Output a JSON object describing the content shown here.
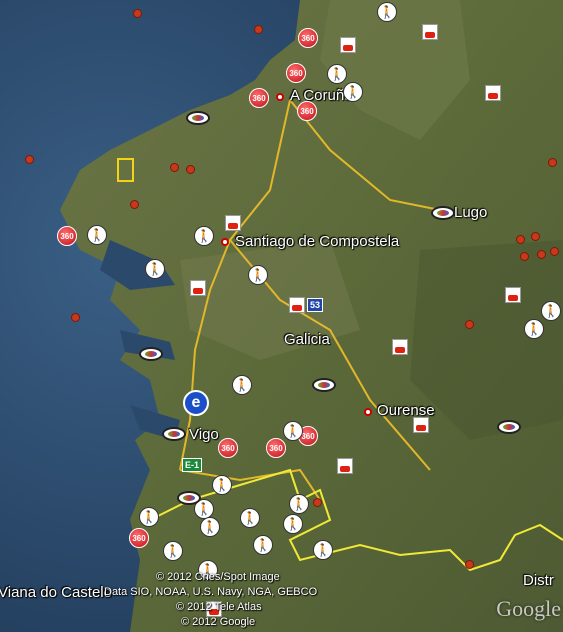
{
  "map": {
    "cities": [
      {
        "name": "A Coruña"
      },
      {
        "name": "Santiago de Compostela"
      },
      {
        "name": "Lugo"
      },
      {
        "name": "Ourense"
      },
      {
        "name": "Vigo"
      },
      {
        "name": "Viana do Castelo"
      },
      {
        "name": "Distr"
      }
    ],
    "region_label": "Galicia",
    "road_shields": [
      {
        "label": "E-1"
      },
      {
        "label": "53"
      }
    ],
    "marker_360_text": "360",
    "attribution": [
      "© 2012 Cnes/Spot Image",
      "Data SIO, NOAA, U.S. Navy, NGA, GEBCO",
      "© 2012 Tele Atlas",
      "© 2012 Google"
    ],
    "logo": "Google",
    "colors": {
      "sea": "#2b4a6b",
      "land": "#5d6b3d",
      "road": "#e2b72a",
      "border": "#f0ea36",
      "poi_360": "#c0101a",
      "small_marker": "#c8391b",
      "walk_icon_bg": "#ffffff",
      "label_text": "#ffffff"
    },
    "icons": [
      "360-photo-icon",
      "hiking-icon",
      "youtube-icon",
      "panoramio-eye-icon",
      "earthquake-dot-icon",
      "wikipedia-icon",
      "airport-icon"
    ]
  }
}
